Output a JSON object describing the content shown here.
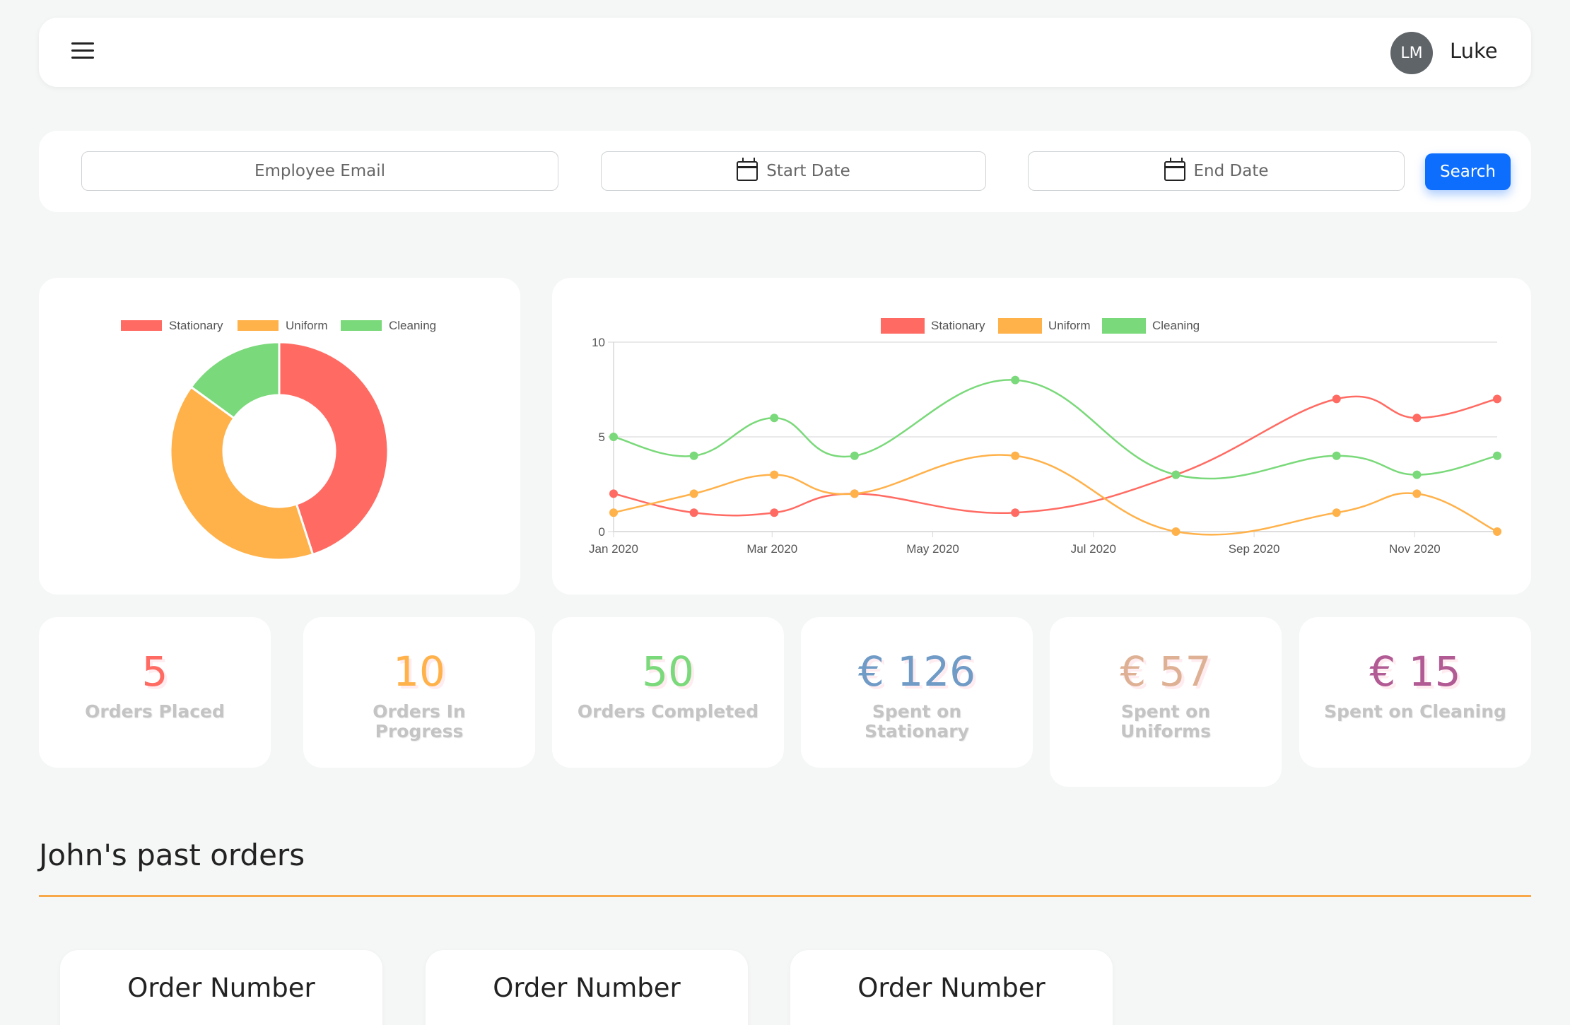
{
  "header": {
    "menu_icon": "hamburger-menu-icon",
    "avatar_initials": "LM",
    "user_name": "Luke"
  },
  "filters": {
    "email_placeholder": "Employee Email",
    "start_date_placeholder": "Start Date",
    "end_date_placeholder": "End Date",
    "calendar_icon": "calendar-icon",
    "search_label": "Search",
    "search_color": "#0d6efd"
  },
  "donut_chart": {
    "legend": [
      "Stationary",
      "Uniform",
      "Cleaning"
    ]
  },
  "line_chart": {
    "legend": [
      "Stationary",
      "Uniform",
      "Cleaning"
    ],
    "y_ticks": [
      "10",
      "5",
      "0"
    ],
    "x_ticks": [
      "Jan 2020",
      "Mar 2020",
      "May 2020",
      "Jul 2020",
      "Sep 2020",
      "Nov 2020"
    ]
  },
  "chart_data": [
    {
      "type": "pie",
      "variant": "doughnut",
      "labels": [
        "Stationary",
        "Uniform",
        "Cleaning"
      ],
      "values": [
        45,
        40,
        15
      ],
      "colors": [
        "#ff6b63",
        "#ffb14a",
        "#7ad97a"
      ],
      "legend_position": "top"
    },
    {
      "type": "line",
      "x": [
        "Jan 2020",
        "Feb 2020",
        "Mar 2020",
        "Apr 2020",
        "May 2020",
        "Jun 2020",
        "Jul 2020",
        "Aug 2020",
        "Sep 2020",
        "Oct 2020",
        "Nov 2020",
        "Dec 2020"
      ],
      "series": [
        {
          "name": "Stationary",
          "color": "#ff6b63",
          "values": [
            2,
            1,
            1,
            2,
            null,
            1,
            null,
            3,
            null,
            7,
            6,
            7
          ]
        },
        {
          "name": "Uniform",
          "color": "#ffb14a",
          "values": [
            1,
            2,
            3,
            2,
            null,
            4,
            null,
            0,
            null,
            1,
            2,
            0
          ]
        },
        {
          "name": "Cleaning",
          "color": "#7ad97a",
          "values": [
            5,
            4,
            6,
            4,
            null,
            8,
            null,
            3,
            null,
            4,
            3,
            4
          ]
        }
      ],
      "ylim": [
        0,
        10
      ],
      "legend_position": "top",
      "grid": true
    }
  ],
  "stats": [
    {
      "value": "5",
      "label": "Orders Placed",
      "color": "#ff6b63"
    },
    {
      "value": "10",
      "label": "Orders In Progress",
      "color": "#ffb14a"
    },
    {
      "value": "50",
      "label": "Orders Completed",
      "color": "#7ad97a"
    },
    {
      "value": "€ 126",
      "label": "Spent on Stationary",
      "color": "#6f9bc6"
    },
    {
      "value": "€ 57",
      "label": "Spent on Uniforms",
      "color": "#deb195"
    },
    {
      "value": "€ 15",
      "label": "Spent on Cleaning",
      "color": "#b15a93"
    }
  ],
  "orders": {
    "heading": "John's past orders",
    "accent_color": "#f8a848",
    "cards": [
      {
        "title": "Order Number"
      },
      {
        "title": "Order Number"
      },
      {
        "title": "Order Number"
      }
    ]
  }
}
